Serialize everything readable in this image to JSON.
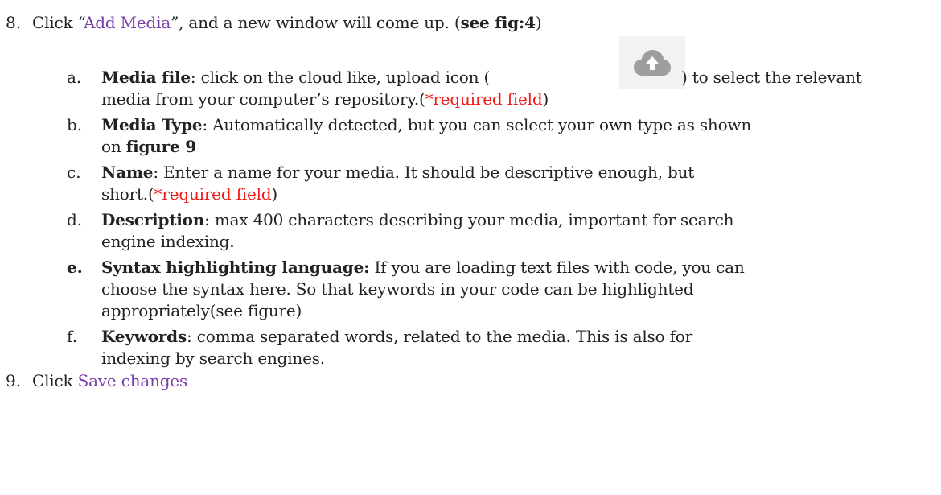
{
  "item8": {
    "number": "8.",
    "prefix": "Click “",
    "link": "Add Media",
    "middle": "”, and a new window will come up. (",
    "bold_ref": "see fig:4",
    "suffix": ")"
  },
  "sub_a": {
    "marker": "a.",
    "term": "Media file",
    "text1": ": click on the cloud like, upload icon (",
    "text2": ") to select the relevant",
    "text3": "media from your computer’s repository.(",
    "required": "*required field",
    "close": ")",
    "icon": "cloud-upload-icon"
  },
  "sub_b": {
    "marker": "b.",
    "term": "Media Type",
    "text1": ": Automatically detected, but you can select your own type as shown",
    "text2": "on ",
    "bold_ref": "figure 9"
  },
  "sub_c": {
    "marker": "c.",
    "term": "Name",
    "text1": ": Enter a name for your media. It should be descriptive enough, but",
    "text2": "short.(",
    "required": "*required field",
    "close": ")"
  },
  "sub_d": {
    "marker": "d.",
    "term": "Description",
    "text1": ": max 400 characters describing your media, important for search",
    "text2": "engine indexing."
  },
  "sub_e": {
    "marker": "e.",
    "term": "Syntax highlighting language:",
    "text1": " If you are loading text files with code, you can",
    "text2": "choose the syntax here. So that keywords in your code can be highlighted",
    "text3": "appropriately(see figure)"
  },
  "sub_f": {
    "marker": "f.",
    "term": "Keywords",
    "text1": ": comma separated words, related to the media. This is also for",
    "text2": "indexing by search engines."
  },
  "item9": {
    "number": "9.",
    "prefix": "Click ",
    "link": "Save changes"
  },
  "colors": {
    "link": "#7a3ea8",
    "required": "#f21a1a",
    "icon": "#9e9e9e"
  }
}
